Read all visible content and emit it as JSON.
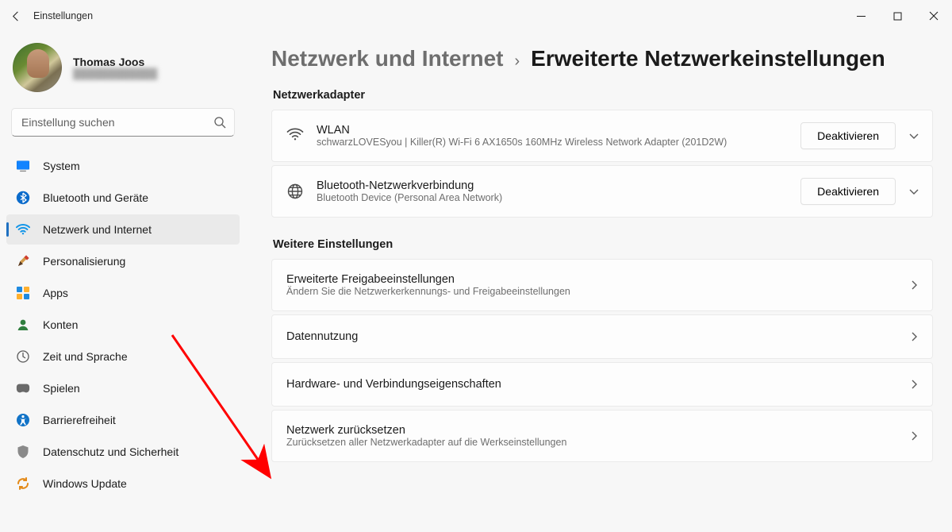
{
  "window": {
    "title": "Einstellungen"
  },
  "profile": {
    "name": "Thomas Joos",
    "email": "redacted"
  },
  "search": {
    "placeholder": "Einstellung suchen"
  },
  "sidebar": {
    "items": [
      {
        "label": "System"
      },
      {
        "label": "Bluetooth und Geräte"
      },
      {
        "label": "Netzwerk und Internet"
      },
      {
        "label": "Personalisierung"
      },
      {
        "label": "Apps"
      },
      {
        "label": "Konten"
      },
      {
        "label": "Zeit und Sprache"
      },
      {
        "label": "Spielen"
      },
      {
        "label": "Barrierefreiheit"
      },
      {
        "label": "Datenschutz und Sicherheit"
      },
      {
        "label": "Windows Update"
      }
    ],
    "selectedIndex": 2
  },
  "breadcrumb": {
    "prev": "Netzwerk und Internet",
    "current": "Erweiterte Netzwerkeinstellungen"
  },
  "adapters": {
    "section_title": "Netzwerkadapter",
    "items": [
      {
        "title": "WLAN",
        "subtitle": "schwarzLOVESyou | Killer(R) Wi-Fi 6 AX1650s 160MHz Wireless Network Adapter (201D2W)",
        "button": "Deaktivieren",
        "icon": "wifi"
      },
      {
        "title": "Bluetooth-Netzwerkverbindung",
        "subtitle": "Bluetooth Device (Personal Area Network)",
        "button": "Deaktivieren",
        "icon": "bt-world"
      }
    ]
  },
  "further": {
    "section_title": "Weitere Einstellungen",
    "items": [
      {
        "title": "Erweiterte Freigabeeinstellungen",
        "subtitle": "Ändern Sie die Netzwerkerkennungs- und Freigabeeinstellungen"
      },
      {
        "title": "Datennutzung"
      },
      {
        "title": "Hardware- und Verbindungseigenschaften"
      },
      {
        "title": "Netzwerk zurücksetzen",
        "subtitle": "Zurücksetzen aller Netzwerkadapter auf die Werkseinstellungen"
      }
    ]
  }
}
